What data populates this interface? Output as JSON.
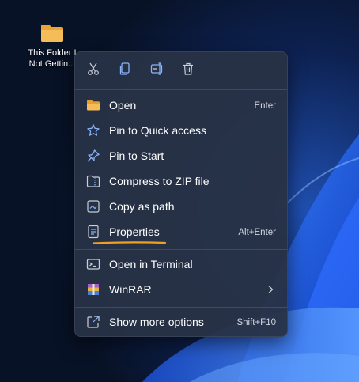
{
  "desktop": {
    "folder_icon": "folder-icon",
    "folder_caption_line1": "This Folder I",
    "folder_caption_line2": "Not Gettin..."
  },
  "toolbar": {
    "items": [
      {
        "icon": "scissors-icon",
        "name": "cut"
      },
      {
        "icon": "copy-icon",
        "name": "copy"
      },
      {
        "icon": "rename-icon",
        "name": "rename"
      },
      {
        "icon": "trash-icon",
        "name": "delete"
      }
    ]
  },
  "menu": {
    "open": {
      "label": "Open",
      "shortcut": "Enter",
      "icon": "folder-icon"
    },
    "pin_quick": {
      "label": "Pin to Quick access",
      "icon": "star-icon"
    },
    "pin_start": {
      "label": "Pin to Start",
      "icon": "pin-icon"
    },
    "zip": {
      "label": "Compress to ZIP file",
      "icon": "zip-icon"
    },
    "copy_path": {
      "label": "Copy as path",
      "icon": "copy-path-icon"
    },
    "properties": {
      "label": "Properties",
      "shortcut": "Alt+Enter",
      "icon": "properties-icon"
    },
    "terminal": {
      "label": "Open in Terminal",
      "icon": "terminal-icon"
    },
    "winrar": {
      "label": "WinRAR",
      "icon": "winrar-icon"
    },
    "more": {
      "label": "Show more options",
      "shortcut": "Shift+F10",
      "icon": "more-options-icon"
    }
  },
  "colors": {
    "accent_underline": "#f0a020",
    "menu_bg": "#283246",
    "folder": "#f3b34c",
    "icon_blue": "#8ab4f8"
  }
}
